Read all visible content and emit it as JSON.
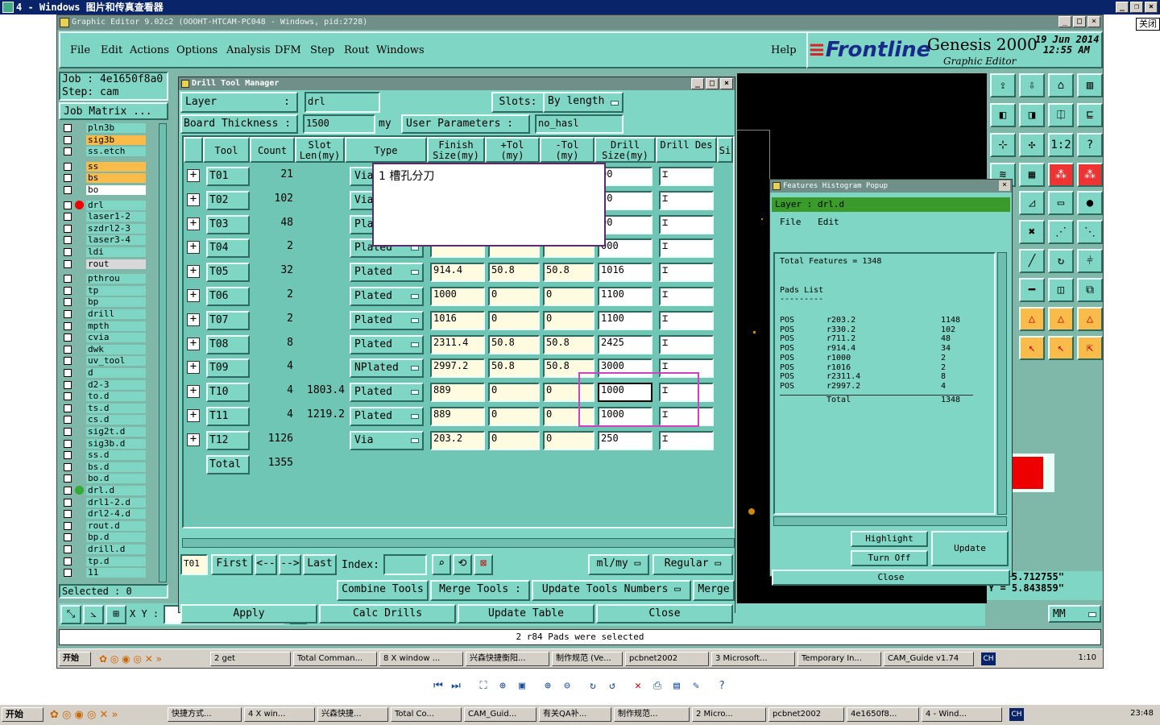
{
  "outer_window": {
    "title": "4 - Windows 图片和传真查看器",
    "close_cn": "关闭"
  },
  "app": {
    "title": "Graphic Editor 9.02c2 (OOOHT-HTCAM-PC048 - Windows, pid:2728)",
    "menu": [
      "File",
      "Edit",
      "Actions",
      "Options",
      "Analysis",
      "DFM",
      "Step",
      "Rout",
      "Windows",
      "Help"
    ],
    "brand": {
      "logo": "Frontline",
      "product": "Genesis 2000",
      "subtitle": "Graphic Editor",
      "date_line1": "19 Jun 2014",
      "date_line2": "12:55 AM"
    }
  },
  "left": {
    "job_label": "Job : 4e1650f8a0",
    "step_label": "Step: cam",
    "job_matrix": "Job Matrix ...",
    "selected": "Selected : 0",
    "layers": [
      {
        "name": "pln3b",
        "style": "normal"
      },
      {
        "name": "sig3b",
        "style": "hl"
      },
      {
        "name": "ss.etch",
        "style": "normal"
      },
      {
        "name": "ss",
        "style": "hl"
      },
      {
        "name": "bs",
        "style": "hl"
      },
      {
        "name": "bo",
        "style": "wh"
      },
      {
        "name": "drl",
        "style": "normal"
      },
      {
        "name": "laser1-2",
        "style": "normal"
      },
      {
        "name": "szdrl2-3",
        "style": "normal"
      },
      {
        "name": "laser3-4",
        "style": "normal"
      },
      {
        "name": "ldi",
        "style": "normal"
      },
      {
        "name": "rout",
        "style": "gr"
      },
      {
        "name": "pthrou",
        "style": "normal"
      },
      {
        "name": "tp",
        "style": "normal"
      },
      {
        "name": "bp",
        "style": "normal"
      },
      {
        "name": "drill",
        "style": "normal"
      },
      {
        "name": "mpth",
        "style": "normal"
      },
      {
        "name": "cvia",
        "style": "normal"
      },
      {
        "name": "dwk",
        "style": "normal"
      },
      {
        "name": "uv_tool",
        "style": "normal"
      },
      {
        "name": "d",
        "style": "normal"
      },
      {
        "name": "d2-3",
        "style": "normal"
      },
      {
        "name": "to.d",
        "style": "normal"
      },
      {
        "name": "ts.d",
        "style": "normal"
      },
      {
        "name": "cs.d",
        "style": "normal"
      },
      {
        "name": "sig2t.d",
        "style": "normal"
      },
      {
        "name": "sig3b.d",
        "style": "normal"
      },
      {
        "name": "ss.d",
        "style": "normal"
      },
      {
        "name": "bs.d",
        "style": "normal"
      },
      {
        "name": "bo.d",
        "style": "normal"
      },
      {
        "name": "drl.d",
        "style": "normal"
      },
      {
        "name": "drl1-2.d",
        "style": "normal"
      },
      {
        "name": "drl2-4.d",
        "style": "normal"
      },
      {
        "name": "rout.d",
        "style": "normal"
      },
      {
        "name": "bp.d",
        "style": "normal"
      },
      {
        "name": "drill.d",
        "style": "normal"
      },
      {
        "name": "tp.d",
        "style": "normal"
      },
      {
        "name": "11",
        "style": "normal"
      }
    ]
  },
  "dtm": {
    "title": "Drill Tool Manager",
    "layer_label": "Layer",
    "layer_value": "drl",
    "slots_label": "Slots:",
    "slots_value": "By length",
    "thick_label": "Board Thickness :",
    "thick_value": "1500",
    "thick_unit": "my",
    "user_params_label": "User Parameters :",
    "user_params_value": "no_hasl",
    "headers": {
      "tool": "Tool",
      "count": "Count",
      "slot": "Slot Len(my)",
      "type": "Type",
      "finish": "Finish Size(my)",
      "ptol": "+Tol (my)",
      "mtol": "-Tol (my)",
      "dsize": "Drill Size(my)",
      "ddes": "Drill Des",
      "si": "Si"
    },
    "rows": [
      {
        "tool": "T01",
        "count": "21",
        "slot": "",
        "type": "Via",
        "finish": "",
        "ptol": "",
        "mtol": "",
        "dsize": "00"
      },
      {
        "tool": "T02",
        "count": "102",
        "slot": "",
        "type": "Via",
        "finish": "",
        "ptol": "",
        "mtol": "",
        "dsize": "50"
      },
      {
        "tool": "T03",
        "count": "48",
        "slot": "",
        "type": "Pla",
        "finish": "",
        "ptol": "",
        "mtol": "",
        "dsize": "00"
      },
      {
        "tool": "T04",
        "count": "2",
        "slot": "",
        "type": "Plated",
        "finish": "",
        "ptol": "",
        "mtol": "",
        "dsize": "000"
      },
      {
        "tool": "T05",
        "count": "32",
        "slot": "",
        "type": "Plated",
        "finish": "914.4",
        "ptol": "50.8",
        "mtol": "50.8",
        "dsize": "1016"
      },
      {
        "tool": "T06",
        "count": "2",
        "slot": "",
        "type": "Plated",
        "finish": "1000",
        "ptol": "0",
        "mtol": "0",
        "dsize": "1100"
      },
      {
        "tool": "T07",
        "count": "2",
        "slot": "",
        "type": "Plated",
        "finish": "1016",
        "ptol": "0",
        "mtol": "0",
        "dsize": "1100"
      },
      {
        "tool": "T08",
        "count": "8",
        "slot": "",
        "type": "Plated",
        "finish": "2311.4",
        "ptol": "50.8",
        "mtol": "50.8",
        "dsize": "2425"
      },
      {
        "tool": "T09",
        "count": "4",
        "slot": "",
        "type": "NPlated",
        "finish": "2997.2",
        "ptol": "50.8",
        "mtol": "50.8",
        "dsize": "3000"
      },
      {
        "tool": "T10",
        "count": "4",
        "slot": "1803.4",
        "type": "Plated",
        "finish": "889",
        "ptol": "0",
        "mtol": "0",
        "dsize": "1000"
      },
      {
        "tool": "T11",
        "count": "4",
        "slot": "1219.2",
        "type": "Plated",
        "finish": "889",
        "ptol": "0",
        "mtol": "0",
        "dsize": "1000"
      },
      {
        "tool": "T12",
        "count": "1126",
        "slot": "",
        "type": "Via",
        "finish": "203.2",
        "ptol": "0",
        "mtol": "0",
        "dsize": "250"
      }
    ],
    "total_label": "Total",
    "total_value": "1355",
    "tooltip": "1 槽孔分刀",
    "nav": {
      "current": "T01",
      "first": "First",
      "prev": "<--",
      "next": "-->",
      "last": "Last",
      "index": "Index:",
      "units": "ml/my",
      "mode": "Regular"
    },
    "actions": {
      "combine": "Combine Tools",
      "merge_tools": "Merge Tools :",
      "update_nums": "Update Tools Numbers",
      "merge": "Merge",
      "apply": "Apply",
      "calc": "Calc Drills",
      "update_table": "Update Table",
      "close": "Close"
    }
  },
  "fhp": {
    "title": "Features Histogram Popup",
    "layer": "Layer : drl.d",
    "menu": [
      "File",
      "Edit"
    ],
    "total_features": "Total Features = 1348",
    "pads_list": "Pads List",
    "underline": "---------",
    "rows": [
      {
        "a": "POS",
        "b": "r203.2",
        "c": "1148"
      },
      {
        "a": "POS",
        "b": "r330.2",
        "c": "102"
      },
      {
        "a": "POS",
        "b": "r711.2",
        "c": "48"
      },
      {
        "a": "POS",
        "b": "r914.4",
        "c": "34"
      },
      {
        "a": "POS",
        "b": "r1000",
        "c": "2"
      },
      {
        "a": "POS",
        "b": "r1016",
        "c": "2"
      },
      {
        "a": "POS",
        "b": "r2311.4",
        "c": "8"
      },
      {
        "a": "POS",
        "b": "r2997.2",
        "c": "4"
      }
    ],
    "total_label": "Total",
    "total_value": "1348",
    "highlight": "Highlight",
    "turn_off": "Turn Off",
    "update": "Update",
    "close": "Close"
  },
  "coords": {
    "x": "X = 5.712755\"",
    "y": "Y = 5.843859\"",
    "units": "MM"
  },
  "xy_label": "X Y :",
  "status": "2 r84 Pads were selected",
  "inner_taskbar": {
    "start": "开始",
    "items": [
      "2 get",
      "Total Comman...",
      "8 X window ...",
      "兴森快捷衡阳...",
      "制作规范 (Ve...",
      "pcbnet2002",
      "3 Microsoft...",
      "Temporary In...",
      "CAM_Guide v1.74"
    ],
    "lang": "CH",
    "clock": "1:10"
  },
  "outer_taskbar": {
    "start": "开始",
    "items": [
      "快捷方式...",
      "4 X win...",
      "兴森快捷...",
      "Total Co...",
      "CAM_Guid...",
      "有关QA补...",
      "制作规范...",
      "2 Micro...",
      "pcbnet2002",
      "4e1650f8...",
      "4 - Wind..."
    ],
    "lang": "CH",
    "clock": "23:48"
  }
}
